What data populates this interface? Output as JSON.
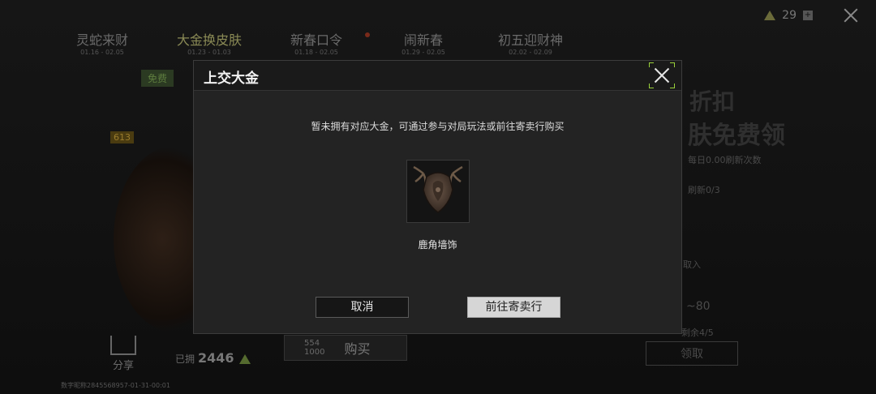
{
  "background": {
    "tabs": [
      {
        "label": "灵蛇来财",
        "dates": "01.16 - 02.05"
      },
      {
        "label": "大金换皮肤",
        "dates": "01.23 - 01.03"
      },
      {
        "label": "新春口令",
        "dates": "01.18 - 02.05"
      },
      {
        "label": "闹新春",
        "dates": "01.29 - 02.05"
      },
      {
        "label": "初五迎财神",
        "dates": "02.02 - 02.09"
      }
    ],
    "currency_count": "29",
    "currency_plus": "+",
    "free_badge": "免费",
    "level_badge": "613",
    "share_label": "分享",
    "owned_label": "已拥",
    "owned_value": "2446",
    "buy_price": "554",
    "buy_sub": "1000",
    "buy_label": "购买",
    "user_id": "数字昵称2845568957-01-31-00:01",
    "promo": {
      "line1": "折扣",
      "line2": "肤免费领",
      "line3": "每日0.00刷新次数",
      "line4": "刷新0/3",
      "line5": "取入",
      "line6": "~80",
      "line7": "剩余4/5",
      "button": "领取"
    }
  },
  "modal": {
    "title": "上交大金",
    "message": "暂未拥有对应大金，可通过参与对局玩法或前往寄卖行购买",
    "item_name": "鹿角墙饰",
    "item_icon": "antler-wall-decoration",
    "cancel_label": "取消",
    "go_label": "前往寄卖行"
  },
  "colors": {
    "modal_bg": "#232323",
    "accent_corner": "#9ad03a",
    "primary_button": "#d6d6d6"
  }
}
